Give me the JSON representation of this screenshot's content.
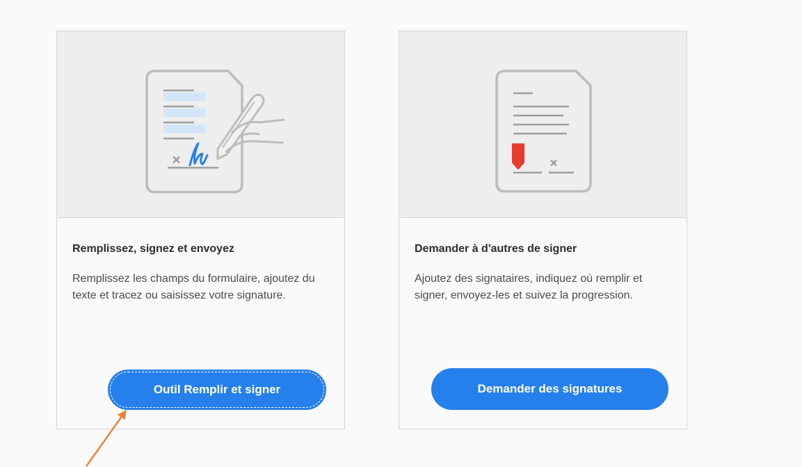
{
  "cards": [
    {
      "title": "Remplissez, signez et envoyez",
      "description": "Remplissez les champs du formulaire, ajoutez du texte et tracez ou saisissez votre signature.",
      "button_label": "Outil Remplir et signer",
      "illustration_icon": "fill-and-sign-document-icon"
    },
    {
      "title": "Demander à d'autres de signer",
      "description": "Ajoutez des signataires, indiquez où remplir et signer, envoyez-les et suivez la progression.",
      "button_label": "Demander des signatures",
      "illustration_icon": "request-signatures-document-icon"
    }
  ],
  "colors": {
    "accent": "#2680eb",
    "annotation_arrow": "#e8833a",
    "signature_marker": "#e83b2f"
  }
}
